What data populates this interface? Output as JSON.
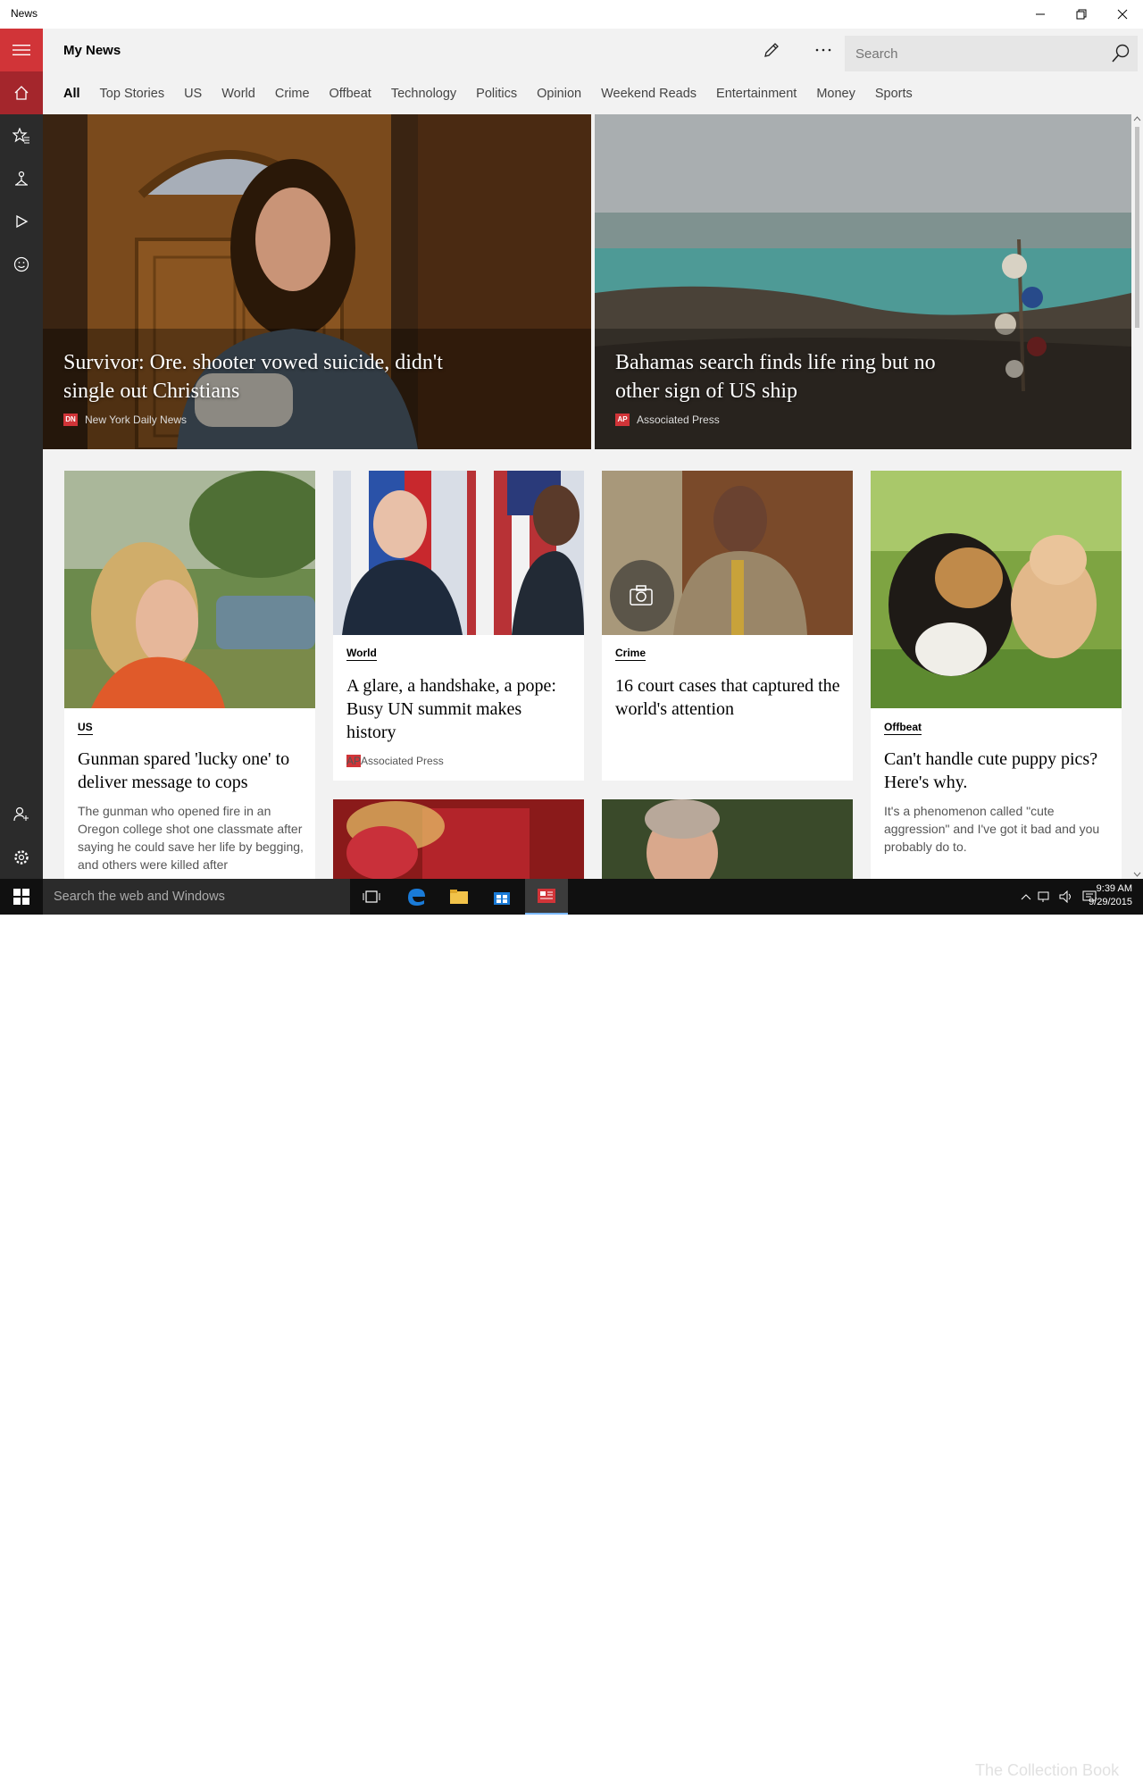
{
  "window": {
    "title": "News",
    "icons": [
      "minimize-icon",
      "restore-icon",
      "close-icon"
    ]
  },
  "header": {
    "title": "My News",
    "search_placeholder": "Search",
    "icons": [
      "pencil-icon",
      "more-icon",
      "search-icon"
    ]
  },
  "rail": {
    "icons": [
      "hamburger-icon",
      "home-icon",
      "favorites-icon",
      "local-icon",
      "video-icon",
      "interests-icon",
      "sign-in-icon",
      "settings-icon"
    ]
  },
  "tabs": [
    "All",
    "Top Stories",
    "US",
    "World",
    "Crime",
    "Offbeat",
    "Technology",
    "Politics",
    "Opinion",
    "Weekend Reads",
    "Entertainment",
    "Money",
    "Sports"
  ],
  "hero": [
    {
      "title": "Survivor: Ore. shooter vowed suicide, didn't single out Christians",
      "source": "New York Daily News",
      "logo": "DN"
    },
    {
      "title": "Bahamas search finds life ring but no other sign of US ship",
      "source": "Associated Press",
      "logo": "AP"
    }
  ],
  "cards": [
    {
      "category": "US",
      "title": "Gunman spared 'lucky one' to deliver message to cops",
      "desc": "The gunman who opened fire in an Oregon college shot one classmate after saying he could save her life by begging, and others were killed after"
    },
    {
      "category": "World",
      "title": "A glare, a handshake, a pope: Busy UN summit makes history",
      "source": "Associated Press",
      "logo": "AP"
    },
    {
      "category": "Crime",
      "title": "16 court cases that captured the world's attention"
    },
    {
      "category": "Offbeat",
      "title": "Can't handle cute puppy pics? Here's why.",
      "desc": "It's a phenomenon called \"cute aggression\" and I've got it bad and you probably do to."
    }
  ],
  "taskbar": {
    "search": "Search the web and Windows",
    "time": "9:39 AM",
    "date": "9/29/2015",
    "watermark": "The Collection Book",
    "icons": [
      "windows-start-icon",
      "task-view-icon",
      "edge-icon",
      "file-explorer-icon",
      "store-icon",
      "news-app-icon",
      "network-icon",
      "volume-icon",
      "action-center-icon"
    ]
  },
  "colors": {
    "accent": "#d13438",
    "accent_dark": "#a4262c",
    "rail": "#2b2b2b",
    "background": "#f2f2f2"
  }
}
